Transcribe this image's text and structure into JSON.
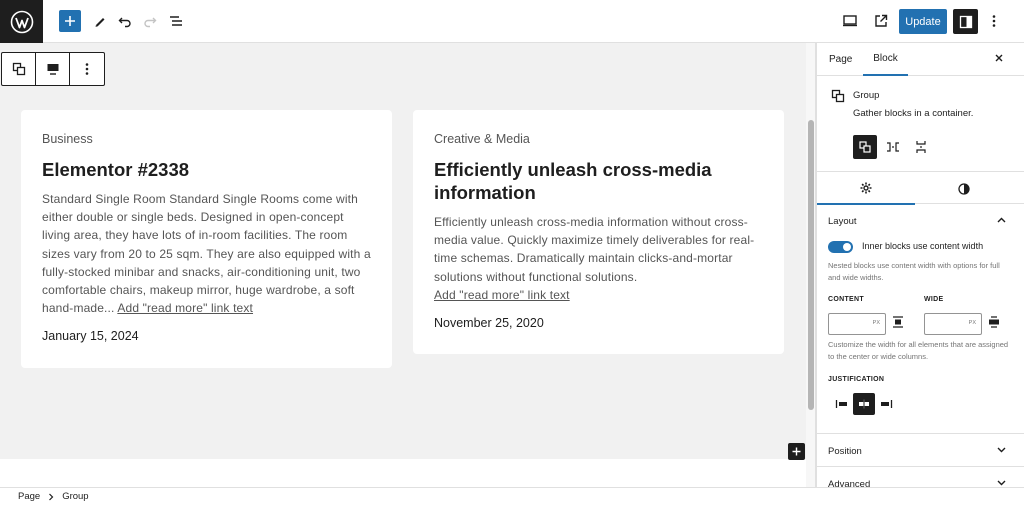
{
  "toolbar": {
    "update_label": "Update"
  },
  "cards": [
    {
      "category": "Business",
      "title": "Elementor #2338",
      "excerpt": "Standard Single Room Standard Single Rooms come with either double or single beds. Designed in open-concept living area, they have lots of in-room facilities. The room sizes vary from 20 to 25 sqm. They are also equipped with a fully-stocked minibar and snacks, air-conditioning unit, two comfortable chairs, makeup mirror, huge wardrobe, a soft hand-made...",
      "read_more": "Add \"read more\" link text",
      "date": "January 15, 2024"
    },
    {
      "category": "Creative & Media",
      "title": "Efficiently unleash cross-media information",
      "excerpt": "Efficiently unleash cross-media information without cross-media value. Quickly maximize timely deliverables for real-time schemas. Dramatically maintain clicks-and-mortar solutions without functional solutions.",
      "read_more": "Add \"read more\" link text",
      "date": "November 25, 2020"
    }
  ],
  "footer": {
    "crumb1": "Page",
    "crumb2": "Group"
  },
  "sidebar": {
    "tab_page": "Page",
    "tab_block": "Block",
    "block_title": "Group",
    "block_desc": "Gather blocks in a container.",
    "layout": {
      "heading": "Layout",
      "toggle_label": "Inner blocks use content width",
      "toggle_on": true,
      "help1": "Nested blocks use content width with options for full and wide widths.",
      "content_label": "CONTENT",
      "wide_label": "WIDE",
      "unit": "PX",
      "help2": "Customize the width for all elements that are assigned to the center or wide columns.",
      "justification_label": "JUSTIFICATION"
    },
    "panels": {
      "position": "Position",
      "advanced": "Advanced"
    }
  },
  "colors": {
    "accent": "#2271b1",
    "dark": "#1e1e1e",
    "canvas": "#f1f1f1"
  }
}
